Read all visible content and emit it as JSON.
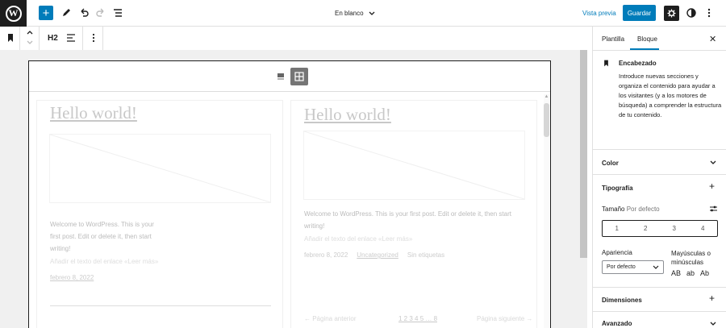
{
  "toolbar": {
    "document_title": "En blanco",
    "preview_label": "Vista previa",
    "save_label": "Guardar"
  },
  "block_toolbar": {
    "heading_level": "H2"
  },
  "canvas": {
    "posts": [
      {
        "title": "Hello world!",
        "excerpt": [
          "Welcome to WordPress. This is your",
          "first post. Edit or delete it, then start",
          "writing!"
        ],
        "read_more": "Añadir el texto del enlace «Leer más»",
        "date": "febrero 8, 2022"
      },
      {
        "title": "Hello world!",
        "excerpt": [
          "Welcome to WordPress. This is your first post. Edit or delete it, then start",
          "writing!"
        ],
        "read_more": "Añadir el texto del enlace «Leer más»",
        "date": "febrero 8, 2022",
        "category": "Uncategorized",
        "tags": "Sin etiquetas"
      }
    ],
    "pagination": {
      "prev": "← Página anterior",
      "pages": "1 2 3 4 5 … 8",
      "next": "Página siguiente →"
    }
  },
  "sidebar": {
    "tabs": [
      "Plantilla",
      "Bloque"
    ],
    "active_tab": "Bloque",
    "block": {
      "name": "Encabezado",
      "description": "Introduce nuevas secciones y organiza el contenido para ayudar a los visitantes (y a los motores de búsqueda) a comprender la estructura de tu contenido."
    },
    "panels": {
      "color": "Color",
      "typography": "Tipografía",
      "dimensions": "Dimensiones",
      "advanced": "Avanzado"
    },
    "typography": {
      "size_label": "Tamaño",
      "size_default": "Por defecto",
      "sizes": [
        "1",
        "2",
        "3",
        "4"
      ],
      "appearance_label": "Apariencia",
      "appearance_value": "Por defecto",
      "case_label": "Mayúsculas o minúsculas",
      "case_options": [
        "AB",
        "ab",
        "Ab"
      ]
    }
  },
  "colors": {
    "accent": "#007cba",
    "dark": "#1e1e1e"
  }
}
